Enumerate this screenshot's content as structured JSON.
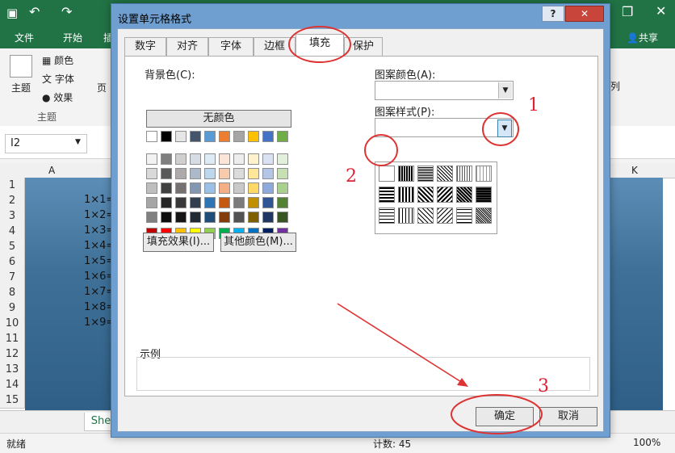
{
  "excel": {
    "ribbon_tabs": [
      "文件",
      "开始",
      "插"
    ],
    "share_label": "共享",
    "theme_group": {
      "theme_label": "主题",
      "colors_label": "颜色",
      "fonts_label": "字体",
      "effects_label": "效果",
      "group_label": "主题"
    },
    "page_label": "页",
    "arrange_label": "列",
    "namebox_value": "I2",
    "columns": [
      "A",
      "K"
    ],
    "rows": [
      "1",
      "2",
      "3",
      "4",
      "5",
      "6",
      "7",
      "8",
      "9",
      "10",
      "11",
      "12",
      "13",
      "14",
      "15"
    ],
    "cells": [
      "1×1=",
      "1×2=",
      "1×3=",
      "1×4=",
      "1×5=",
      "1×6=",
      "1×7=",
      "1×8=",
      "1×9="
    ],
    "sheet_tab": "She",
    "status": {
      "ready": "就绪",
      "count": "计数: 45",
      "zoom": "100%"
    }
  },
  "dialog": {
    "title": "设置单元格格式",
    "help": "?",
    "close": "✕",
    "tabs": [
      "数字",
      "对齐",
      "字体",
      "边框",
      "填充",
      "保护"
    ],
    "active_tab": "填充",
    "background_label": "背景色(C):",
    "no_color_button": "无颜色",
    "fill_effects_button": "填充效果(I)...",
    "more_colors_button": "其他颜色(M)...",
    "pattern_color_label": "图案颜色(A):",
    "pattern_style_label": "图案样式(P):",
    "sample_label": "示例",
    "ok_button": "确定",
    "cancel_button": "取消",
    "theme_colors": [
      [
        "#ffffff",
        "#000000",
        "#e7e6e6",
        "#44546a",
        "#5b9bd5",
        "#ed7d31",
        "#a5a5a5",
        "#ffc000",
        "#4472c4",
        "#70ad47"
      ],
      [
        "#f2f2f2",
        "#7f7f7f",
        "#d0cece",
        "#d6dce4",
        "#ddebf7",
        "#fce4d6",
        "#ededed",
        "#fff2cc",
        "#d9e1f2",
        "#e2efda"
      ],
      [
        "#d9d9d9",
        "#595959",
        "#aeaaaa",
        "#acb9ca",
        "#bdd7ee",
        "#f8cbad",
        "#dbdbdb",
        "#ffe699",
        "#b4c6e7",
        "#c6e0b4"
      ],
      [
        "#bfbfbf",
        "#404040",
        "#757171",
        "#8497b0",
        "#9bc2e6",
        "#f4b084",
        "#c9c9c9",
        "#ffd966",
        "#8ea9db",
        "#a9d08e"
      ],
      [
        "#a6a6a6",
        "#262626",
        "#3a3838",
        "#333f4f",
        "#2f75b5",
        "#c65911",
        "#7b7b7b",
        "#bf8f00",
        "#2f5597",
        "#548235"
      ],
      [
        "#808080",
        "#0d0d0d",
        "#161616",
        "#222b35",
        "#1f4e78",
        "#843c0c",
        "#525252",
        "#7f6000",
        "#203764",
        "#375623"
      ]
    ],
    "standard_colors": [
      "#c00000",
      "#ff0000",
      "#ffc000",
      "#ffff00",
      "#92d050",
      "#00b050",
      "#00b0f0",
      "#0070c0",
      "#002060",
      "#7030a0"
    ]
  },
  "annotations": {
    "marker_1": "1",
    "marker_2": "2",
    "marker_3": "3"
  }
}
